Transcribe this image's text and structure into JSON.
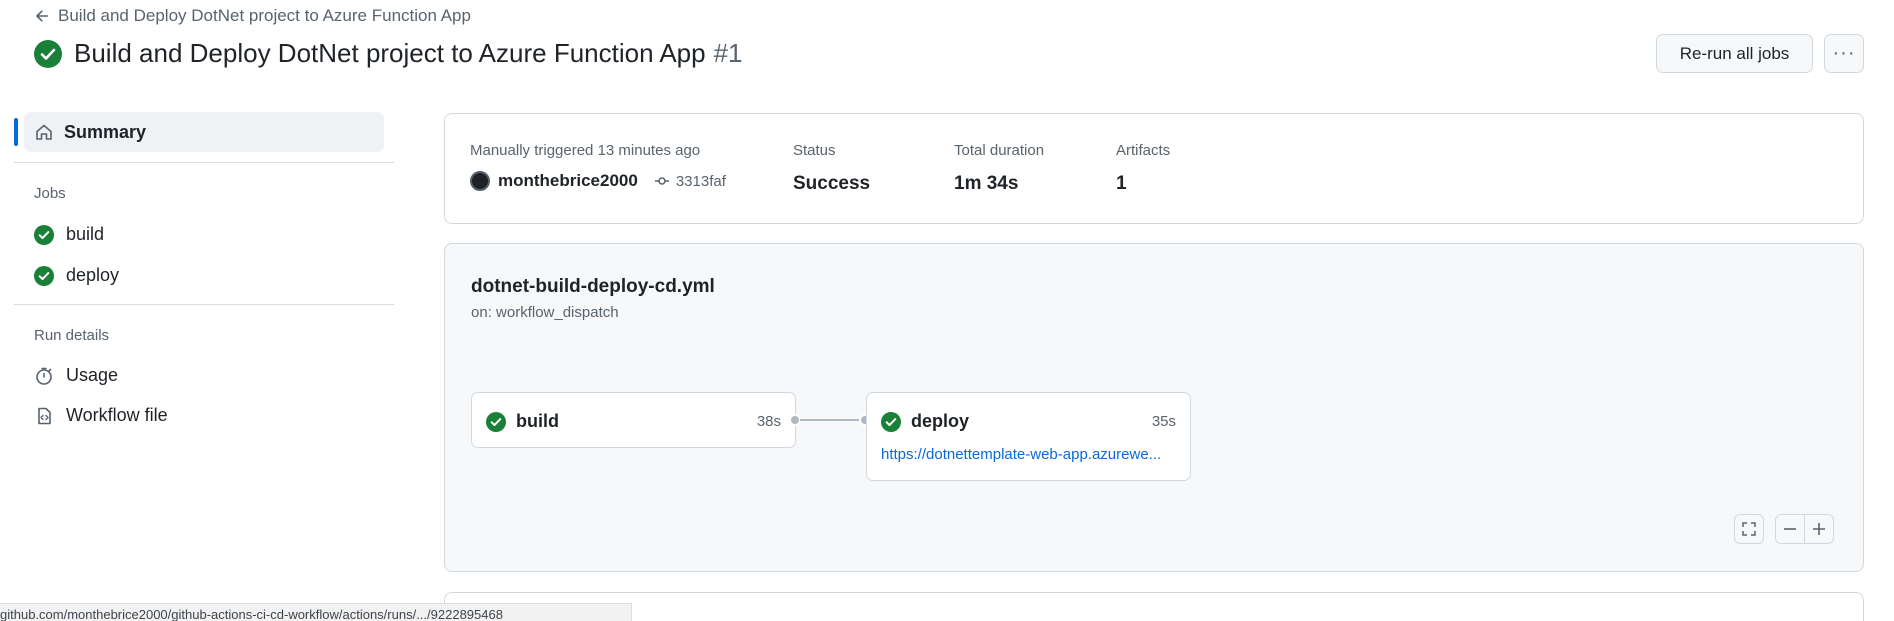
{
  "header": {
    "back_link": "Build and Deploy DotNet project to Azure Function App",
    "title": "Build and Deploy DotNet project to Azure Function App",
    "run_number": "#1",
    "rerun_label": "Re-run all jobs",
    "more_label": "···"
  },
  "sidebar": {
    "summary_label": "Summary",
    "jobs_heading": "Jobs",
    "jobs": [
      {
        "label": "build",
        "status": "success"
      },
      {
        "label": "deploy",
        "status": "success"
      }
    ],
    "run_details_heading": "Run details",
    "run_details": [
      {
        "label": "Usage",
        "icon": "stopwatch-icon"
      },
      {
        "label": "Workflow file",
        "icon": "file-code-icon"
      }
    ]
  },
  "summary": {
    "trigger_label": "Manually triggered 13 minutes ago",
    "user": "monthebrice2000",
    "commit": "3313faf",
    "status_label": "Status",
    "status_value": "Success",
    "duration_label": "Total duration",
    "duration_value": "1m 34s",
    "artifacts_label": "Artifacts",
    "artifacts_value": "1"
  },
  "workflow": {
    "file": "dotnet-build-deploy-cd.yml",
    "trigger": "on: workflow_dispatch",
    "jobs": [
      {
        "name": "build",
        "duration": "38s"
      },
      {
        "name": "deploy",
        "duration": "35s",
        "url": "https://dotnettemplate-web-app.azurewe..."
      }
    ]
  },
  "status_bar": {
    "url": "github.com/monthebrice2000/github-actions-ci-cd-workflow/actions/runs/.../9222895468"
  },
  "colors": {
    "success": "#1a7f37",
    "accent": "#0969da",
    "muted": "#59636e"
  }
}
